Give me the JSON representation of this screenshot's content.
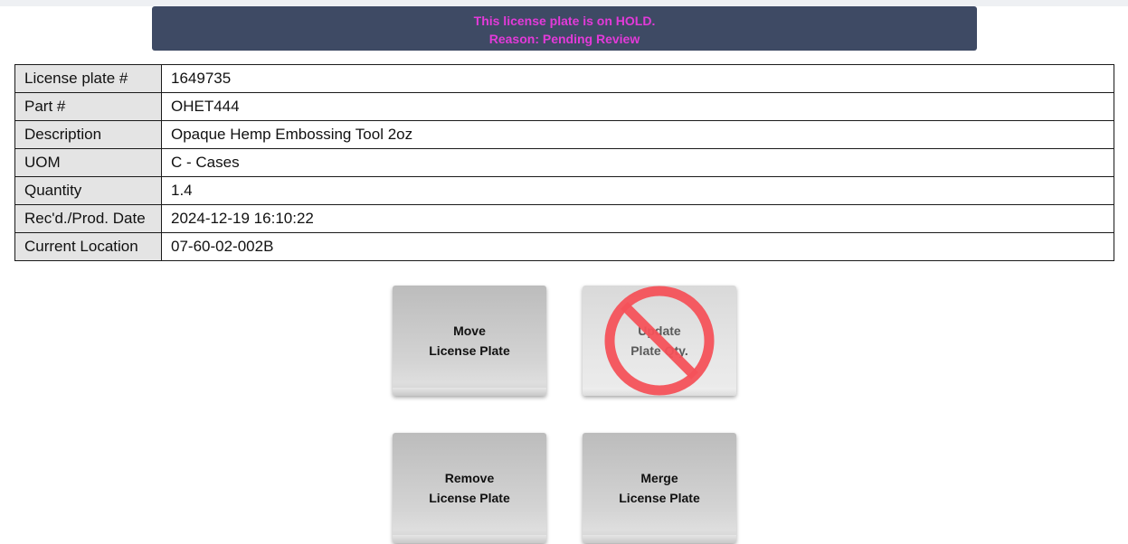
{
  "banner": {
    "line1": "This license plate is on HOLD.",
    "line2": "Reason: Pending Review",
    "text_color": "#e33ad9",
    "background": "#3e4a64"
  },
  "details": [
    {
      "label": "License plate #",
      "value": "1649735"
    },
    {
      "label": "Part #",
      "value": "OHET444"
    },
    {
      "label": "Description",
      "value": "Opaque Hemp Embossing Tool 2oz"
    },
    {
      "label": "UOM",
      "value": "C - Cases"
    },
    {
      "label": "Quantity",
      "value": "1.4"
    },
    {
      "label": "Rec'd./Prod. Date",
      "value": "2024-12-19 16:10:22"
    },
    {
      "label": "Current Location",
      "value": "07-60-02-002B"
    }
  ],
  "actions": {
    "move": {
      "line1": "Move",
      "line2": "License Plate",
      "enabled": true
    },
    "update_qty": {
      "line1": "Update",
      "line2": "Plate Qty.",
      "enabled": false,
      "overlay_icon": "prohibited-icon",
      "overlay_color": "#f4525a"
    },
    "remove": {
      "line1": "Remove",
      "line2": "License Plate",
      "enabled": true
    },
    "merge": {
      "line1": "Merge",
      "line2": "License Plate",
      "enabled": true
    }
  }
}
